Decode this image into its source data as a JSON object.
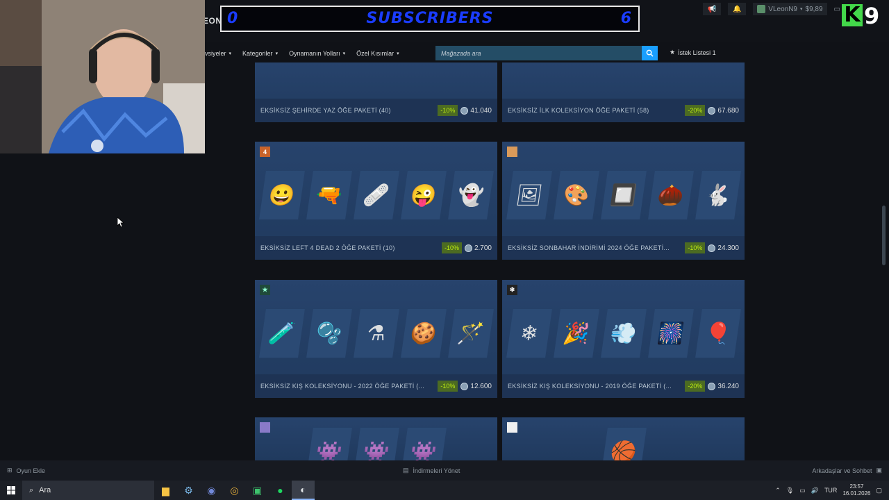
{
  "overlay": {
    "left_count": "0",
    "title": "SUBSCRIBERS",
    "right_count": "6",
    "logo_k": "K",
    "logo_9": "9"
  },
  "steam": {
    "brand": "EONN",
    "user": "VLeonN9",
    "balance": "$9,89",
    "nav": [
      {
        "label": "avsiyeler"
      },
      {
        "label": "Kategoriler"
      },
      {
        "label": "Oynamanın Yolları"
      },
      {
        "label": "Özel Kısımlar"
      }
    ],
    "search_placeholder": "Mağazada ara",
    "wishlist_label": "İstek Listesi 1"
  },
  "cards": [
    {
      "title": "EKSİKSİZ ŞEHİRDE YAZ ÖĞE PAKETİ (40)",
      "discount": "-10%",
      "price": "41.040",
      "badge_icon": "none",
      "items": []
    },
    {
      "title": "EKSİKSİZ İLK KOLEKSİYON ÖĞE PAKETİ (58)",
      "discount": "-20%",
      "price": "67.680",
      "badge_icon": "none",
      "items": []
    },
    {
      "title": "EKSİKSİZ LEFT 4 DEAD 2 ÖĞE PAKETİ (10)",
      "discount": "-10%",
      "price": "2.700",
      "badge_icon": "4",
      "items": [
        "😀",
        "🔫",
        "🩹",
        "😜",
        "👻"
      ]
    },
    {
      "title": "EKSİKSİZ SONBAHAR İNDİRİMİ 2024 ÖĞE PAKETİ...",
      "discount": "-10%",
      "price": "24.300",
      "badge_icon": "",
      "items": [
        "🖼",
        "🎨",
        "🔲",
        "🌰",
        "🐇"
      ]
    },
    {
      "title": "EKSİKSİZ KIŞ KOLEKSİYONU - 2022 ÖĞE PAKETİ (...",
      "discount": "-10%",
      "price": "12.600",
      "badge_icon": "★",
      "items": [
        "🧪",
        "🫧",
        "⚗",
        "🍪",
        "🪄"
      ]
    },
    {
      "title": "EKSİKSİZ KIŞ KOLEKSİYONU - 2019 ÖĞE PAKETİ (...",
      "discount": "-20%",
      "price": "36.240",
      "badge_icon": "❄",
      "items": [
        "❄",
        "🎉",
        "💨",
        "🎆",
        "🎈"
      ]
    },
    {
      "title": "",
      "discount": "",
      "price": "",
      "badge_icon": "",
      "items": [
        "👾",
        "👾",
        "👾"
      ]
    },
    {
      "title": "",
      "discount": "",
      "price": "",
      "badge_icon": "",
      "items": [
        "🏀"
      ]
    }
  ],
  "bottombar": {
    "add_game": "Oyun Ekle",
    "downloads": "İndirmeleri Yönet",
    "friends": "Arkadaşlar ve Sohbet"
  },
  "taskbar": {
    "search_label": "Ara",
    "lang": "TUR",
    "time": "23:57",
    "date": "16.01.2026"
  }
}
